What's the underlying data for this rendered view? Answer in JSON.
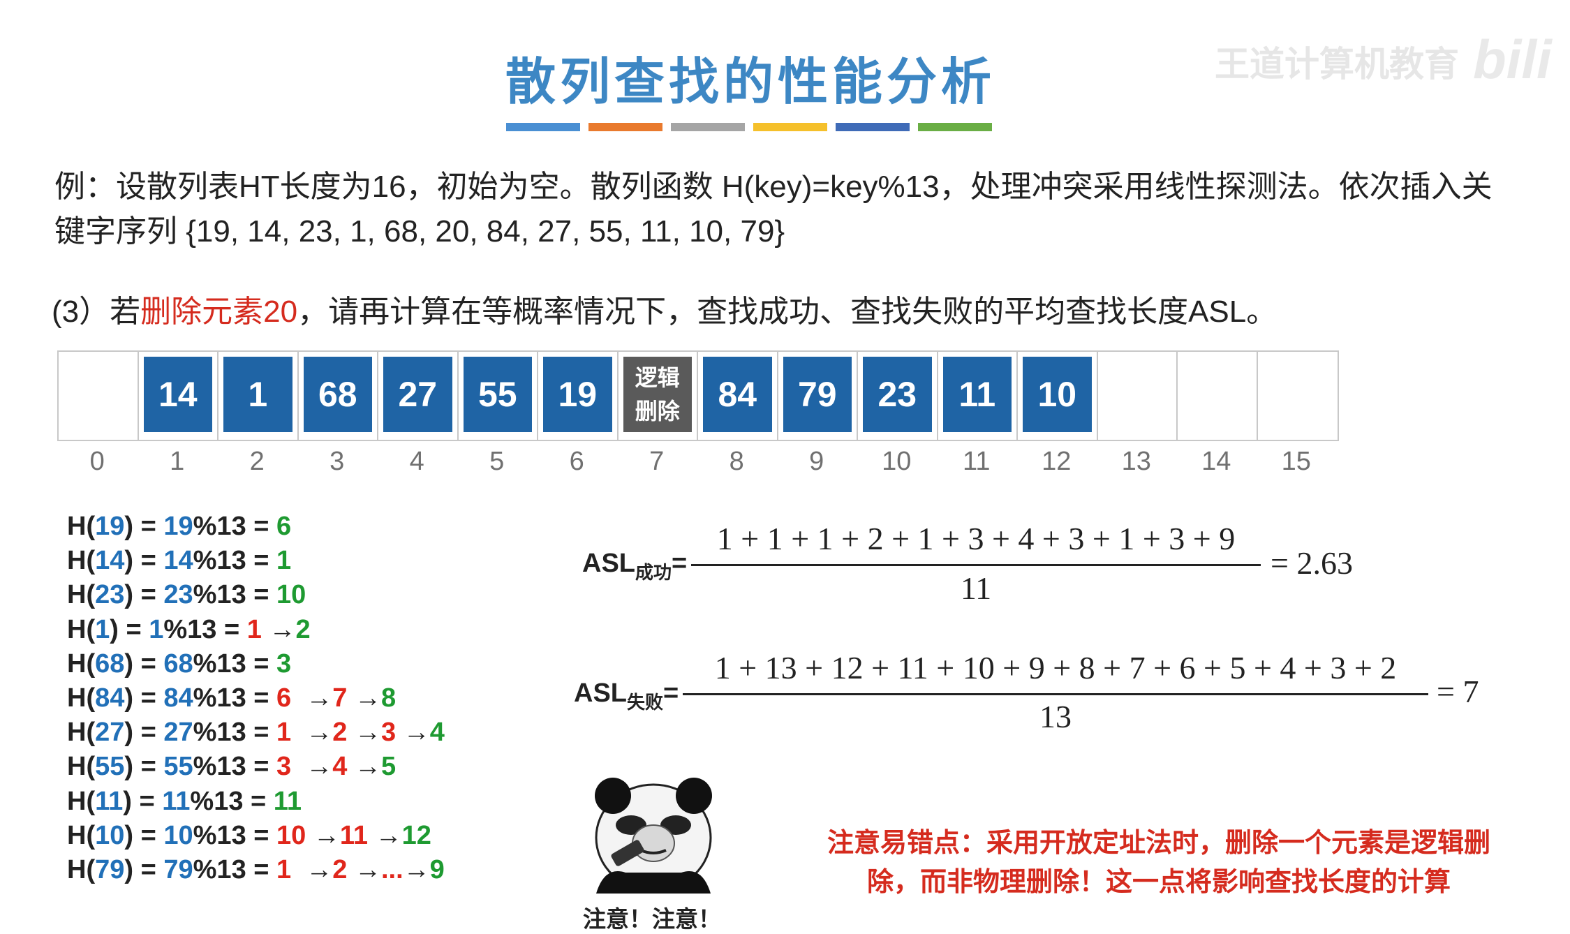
{
  "title": "散列查找的性能分析",
  "title_bar_colors": [
    "#4a8fd3",
    "#e97a2e",
    "#a5a5a5",
    "#f5c02b",
    "#3f6bb7",
    "#6aae45"
  ],
  "watermark": "王道计算机教育",
  "watermark_logo": "bili",
  "problem_text": "例：设散列表HT长度为16，初始为空。散列函数 H(key)=key%13，处理冲突采用线性探测法。依次插入关键字序列 {19, 14, 23, 1, 68, 20, 84, 27, 55, 11, 10, 79}",
  "question": {
    "prefix": "(3）若",
    "highlight": "删除元素20",
    "suffix": "，请再计算在等概率情况下，查找成功、查找失败的平均查找长度ASL。"
  },
  "table": {
    "cells": [
      "",
      "14",
      "1",
      "68",
      "27",
      "55",
      "19",
      "逻辑删除",
      "84",
      "79",
      "23",
      "11",
      "10",
      "",
      "",
      ""
    ],
    "indices": [
      "0",
      "1",
      "2",
      "3",
      "4",
      "5",
      "6",
      "7",
      "8",
      "9",
      "10",
      "11",
      "12",
      "13",
      "14",
      "15"
    ],
    "deleted_cell_lines": [
      "逻辑",
      "删除"
    ]
  },
  "hash_lines": [
    [
      {
        "t": "H(",
        "c": "k"
      },
      {
        "t": "19",
        "c": "b"
      },
      {
        "t": ") = ",
        "c": "k"
      },
      {
        "t": "19",
        "c": "b"
      },
      {
        "t": "%13 = ",
        "c": "k"
      },
      {
        "t": "6",
        "c": "g"
      }
    ],
    [
      {
        "t": "H(",
        "c": "k"
      },
      {
        "t": "14",
        "c": "b"
      },
      {
        "t": ") = ",
        "c": "k"
      },
      {
        "t": "14",
        "c": "b"
      },
      {
        "t": "%13 = ",
        "c": "k"
      },
      {
        "t": "1",
        "c": "g"
      }
    ],
    [
      {
        "t": "H(",
        "c": "k"
      },
      {
        "t": "23",
        "c": "b"
      },
      {
        "t": ") = ",
        "c": "k"
      },
      {
        "t": "23",
        "c": "b"
      },
      {
        "t": "%13 = ",
        "c": "k"
      },
      {
        "t": "10",
        "c": "g"
      }
    ],
    [
      {
        "t": "H(",
        "c": "k"
      },
      {
        "t": "1",
        "c": "b"
      },
      {
        "t": ") = ",
        "c": "k"
      },
      {
        "t": "1",
        "c": "b"
      },
      {
        "t": "%13 = ",
        "c": "k"
      },
      {
        "t": "1",
        "c": "r"
      },
      {
        "t": " →",
        "c": "k"
      },
      {
        "t": "2",
        "c": "g"
      }
    ],
    [
      {
        "t": "H(",
        "c": "k"
      },
      {
        "t": "68",
        "c": "b"
      },
      {
        "t": ") = ",
        "c": "k"
      },
      {
        "t": "68",
        "c": "b"
      },
      {
        "t": "%13 = ",
        "c": "k"
      },
      {
        "t": "3",
        "c": "g"
      }
    ],
    [
      {
        "t": "H(",
        "c": "k"
      },
      {
        "t": "84",
        "c": "b"
      },
      {
        "t": ") = ",
        "c": "k"
      },
      {
        "t": "84",
        "c": "b"
      },
      {
        "t": "%13 = ",
        "c": "k"
      },
      {
        "t": "6",
        "c": "r"
      },
      {
        "t": "  →",
        "c": "k"
      },
      {
        "t": "7",
        "c": "r"
      },
      {
        "t": " →",
        "c": "k"
      },
      {
        "t": "8",
        "c": "g"
      }
    ],
    [
      {
        "t": "H(",
        "c": "k"
      },
      {
        "t": "27",
        "c": "b"
      },
      {
        "t": ") = ",
        "c": "k"
      },
      {
        "t": "27",
        "c": "b"
      },
      {
        "t": "%13 = ",
        "c": "k"
      },
      {
        "t": "1",
        "c": "r"
      },
      {
        "t": "  →",
        "c": "k"
      },
      {
        "t": "2",
        "c": "r"
      },
      {
        "t": " →",
        "c": "k"
      },
      {
        "t": "3",
        "c": "r"
      },
      {
        "t": " →",
        "c": "k"
      },
      {
        "t": "4",
        "c": "g"
      }
    ],
    [
      {
        "t": "H(",
        "c": "k"
      },
      {
        "t": "55",
        "c": "b"
      },
      {
        "t": ") = ",
        "c": "k"
      },
      {
        "t": "55",
        "c": "b"
      },
      {
        "t": "%13 = ",
        "c": "k"
      },
      {
        "t": "3",
        "c": "r"
      },
      {
        "t": "  →",
        "c": "k"
      },
      {
        "t": "4",
        "c": "r"
      },
      {
        "t": " →",
        "c": "k"
      },
      {
        "t": "5",
        "c": "g"
      }
    ],
    [
      {
        "t": "H(",
        "c": "k"
      },
      {
        "t": "11",
        "c": "b"
      },
      {
        "t": ") = ",
        "c": "k"
      },
      {
        "t": "11",
        "c": "b"
      },
      {
        "t": "%13 = ",
        "c": "k"
      },
      {
        "t": "11",
        "c": "g"
      }
    ],
    [
      {
        "t": "H(",
        "c": "k"
      },
      {
        "t": "10",
        "c": "b"
      },
      {
        "t": ") = ",
        "c": "k"
      },
      {
        "t": "10",
        "c": "b"
      },
      {
        "t": "%13 = ",
        "c": "k"
      },
      {
        "t": "10",
        "c": "r"
      },
      {
        "t": " →",
        "c": "k"
      },
      {
        "t": "11",
        "c": "r"
      },
      {
        "t": " →",
        "c": "k"
      },
      {
        "t": "12",
        "c": "g"
      }
    ],
    [
      {
        "t": "H(",
        "c": "k"
      },
      {
        "t": "79",
        "c": "b"
      },
      {
        "t": ") = ",
        "c": "k"
      },
      {
        "t": "79",
        "c": "b"
      },
      {
        "t": "%13 = ",
        "c": "k"
      },
      {
        "t": "1",
        "c": "r"
      },
      {
        "t": "  →",
        "c": "k"
      },
      {
        "t": "2",
        "c": "r"
      },
      {
        "t": " →",
        "c": "k"
      },
      {
        "t": "...",
        "c": "r"
      },
      {
        "t": "→",
        "c": "k"
      },
      {
        "t": "9",
        "c": "g"
      }
    ]
  ],
  "asl_success": {
    "label": "ASL",
    "sub": "成功",
    "eq": "=",
    "numerator": "1 + 1 + 1 + 2 + 1 + 3 + 4 + 3 + 1 + 3 + 9",
    "denominator": "11",
    "result": "= 2.63"
  },
  "asl_fail": {
    "label": "ASL",
    "sub": "失败",
    "eq": "=",
    "numerator": "1 + 13 + 12 + 11 + 10 + 9 + 8 + 7 + 6 + 5 + 4 + 3 + 2",
    "denominator": "13",
    "result": "= 7"
  },
  "meme_caption": "注意！注意！",
  "note": "注意易错点：采用开放定址法时，删除一个元素是逻辑删除，而非物理删除！这一点将影响查找长度的计算",
  "colors": {
    "blue": "#2170b8",
    "red": "#e0261b",
    "green": "#1e9a31",
    "cell": "#1f64a5",
    "deleted": "#5a5a5a"
  }
}
